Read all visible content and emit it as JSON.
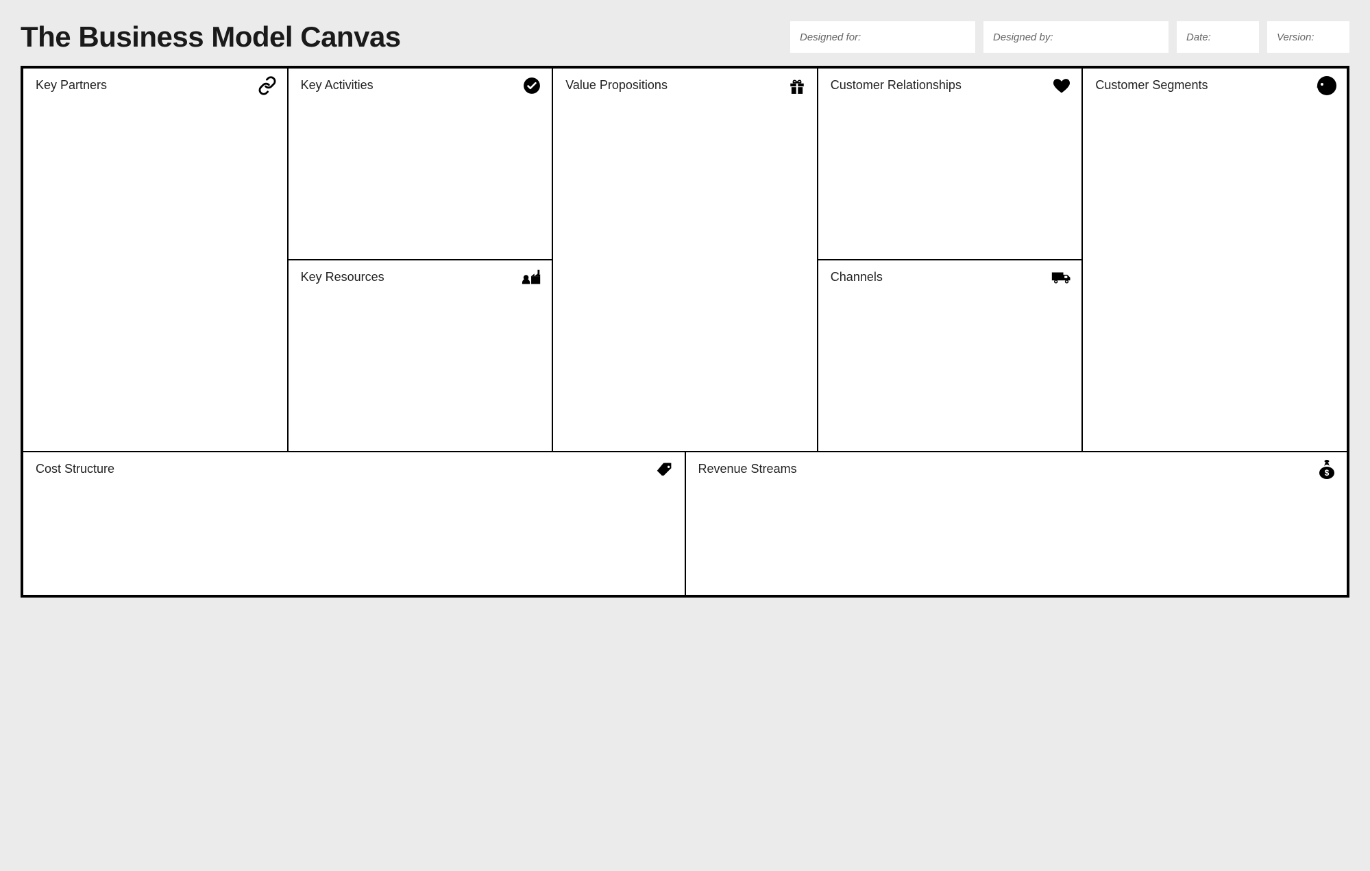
{
  "title": "The Business Model Canvas",
  "meta": {
    "designed_for_label": "Designed for:",
    "designed_by_label": "Designed by:",
    "date_label": "Date:",
    "version_label": "Version:"
  },
  "sections": {
    "key_partners": {
      "title": "Key Partners",
      "icon": "link-icon"
    },
    "key_activities": {
      "title": "Key Activities",
      "icon": "check-circle-icon"
    },
    "key_resources": {
      "title": "Key Resources",
      "icon": "factory-icon"
    },
    "value_propositions": {
      "title": "Value Propositions",
      "icon": "gift-icon"
    },
    "customer_relationships": {
      "title": "Customer Relationships",
      "icon": "heart-icon"
    },
    "channels": {
      "title": "Channels",
      "icon": "truck-icon"
    },
    "customer_segments": {
      "title": "Customer Segments",
      "icon": "head-icon"
    },
    "cost_structure": {
      "title": "Cost Structure",
      "icon": "tag-icon"
    },
    "revenue_streams": {
      "title": "Revenue Streams",
      "icon": "money-bag-icon"
    }
  }
}
